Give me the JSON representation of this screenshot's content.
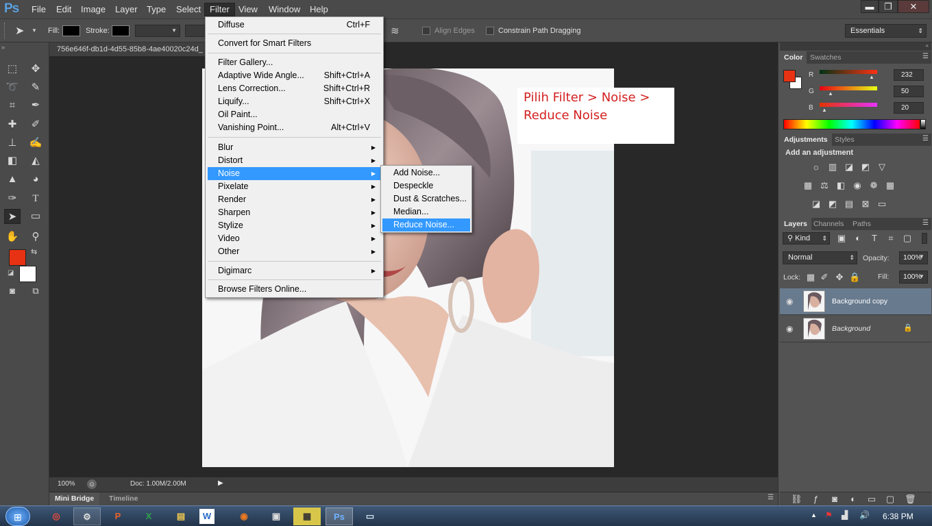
{
  "app": {
    "logo": "Ps"
  },
  "menubar": {
    "items": [
      "File",
      "Edit",
      "Image",
      "Layer",
      "Type",
      "Select",
      "Filter",
      "View",
      "Window",
      "Help"
    ]
  },
  "window_controls": {
    "minimize": "▬",
    "restore": "❐",
    "close": "✕"
  },
  "options_bar": {
    "fill_label": "Fill:",
    "stroke_label": "Stroke:",
    "align_edges": "Align Edges",
    "constrain_path": "Constrain Path Dragging",
    "workspace": "Essentials"
  },
  "document": {
    "tab_title": "756e646f-db1d-4d55-85b8-4ae40020c24d_",
    "zoom": "100%",
    "doc_size": "Doc: 1.00M/2.00M",
    "annotation_line1": "Pilih Filter > Noise >",
    "annotation_line2": "Reduce Noise"
  },
  "filter_menu": {
    "last_filter": {
      "label": "Diffuse",
      "shortcut": "Ctrl+F"
    },
    "smart": "Convert for Smart Filters",
    "gallery": [
      {
        "label": "Filter Gallery...",
        "shortcut": ""
      },
      {
        "label": "Adaptive Wide Angle...",
        "shortcut": "Shift+Ctrl+A"
      },
      {
        "label": "Lens Correction...",
        "shortcut": "Shift+Ctrl+R"
      },
      {
        "label": "Liquify...",
        "shortcut": "Shift+Ctrl+X"
      },
      {
        "label": "Oil Paint...",
        "shortcut": ""
      },
      {
        "label": "Vanishing Point...",
        "shortcut": "Alt+Ctrl+V"
      }
    ],
    "groups": [
      "Blur",
      "Distort",
      "Noise",
      "Pixelate",
      "Render",
      "Sharpen",
      "Stylize",
      "Video",
      "Other"
    ],
    "digimarc": "Digimarc",
    "browse": "Browse Filters Online...",
    "highlighted": "Noise"
  },
  "noise_submenu": {
    "items": [
      "Add Noise...",
      "Despeckle",
      "Dust & Scratches...",
      "Median...",
      "Reduce Noise..."
    ],
    "highlighted": "Reduce Noise..."
  },
  "color_panel": {
    "tabs": [
      "Color",
      "Swatches"
    ],
    "r_label": "R",
    "g_label": "G",
    "b_label": "B",
    "r": "232",
    "g": "50",
    "b": "20",
    "foreground": "#e83214",
    "background": "#ffffff"
  },
  "adjustments_panel": {
    "tabs": [
      "Adjustments",
      "Styles"
    ],
    "heading": "Add an adjustment"
  },
  "layers_panel": {
    "tabs": [
      "Layers",
      "Channels",
      "Paths"
    ],
    "kind": "Kind",
    "blend_mode": "Normal",
    "opacity_label": "Opacity:",
    "opacity": "100%",
    "lock_label": "Lock:",
    "fill_label": "Fill:",
    "fill": "100%",
    "layers": [
      {
        "name": "Background copy",
        "selected": true,
        "locked": false
      },
      {
        "name": "Background",
        "selected": false,
        "locked": true
      }
    ]
  },
  "bottom_tabs": [
    "Mini Bridge",
    "Timeline"
  ],
  "taskbar": {
    "time": "6:38 PM"
  }
}
